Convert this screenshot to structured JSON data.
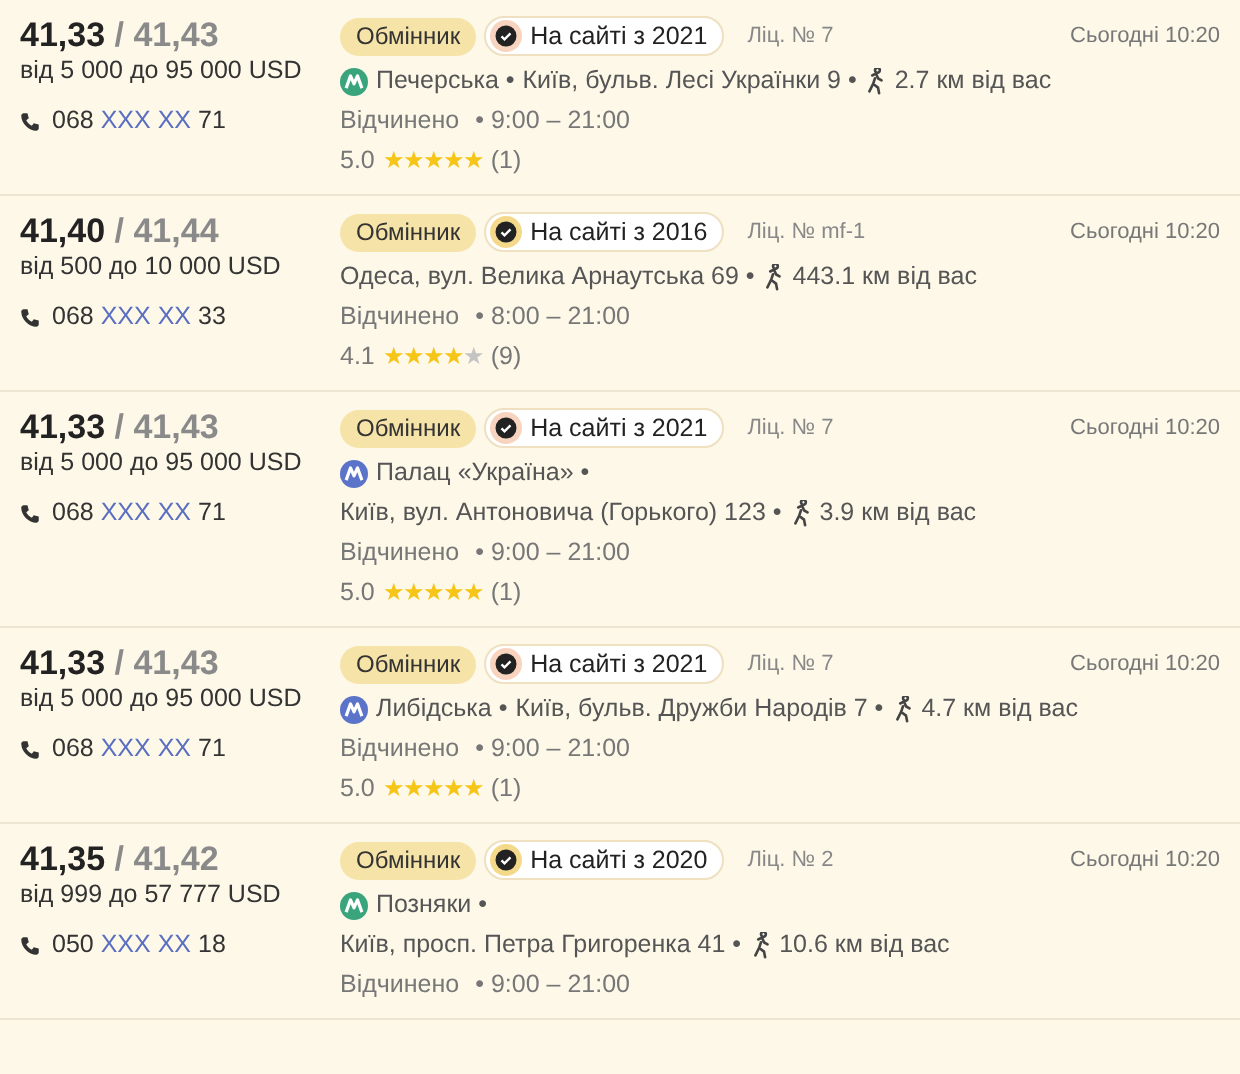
{
  "offers": [
    {
      "buy": "41,33",
      "sell": "/ 41,43",
      "range": "від 5 000 до 95 000 USD",
      "phone": {
        "prefix": "068",
        "hidden": "XXX XX",
        "suffix": "71"
      },
      "type_badge": "Обмінник",
      "since": {
        "text": "На сайті з 2021",
        "color": "#f8d3bd"
      },
      "license": "Ліц. № 7",
      "time": "Сьогодні 10:20",
      "metro": {
        "name": "Печерська •",
        "color": "#3aa57c"
      },
      "address": "Київ, бульв. Лесі Українки 9 •",
      "address_on_new_line": false,
      "distance": "2.7",
      "distance_unit": "км від вас",
      "status": "Відчинено",
      "hours": "• 9:00 – 21:00",
      "rating": "5.0",
      "stars": 5,
      "reviews": "(1)"
    },
    {
      "buy": "41,40",
      "sell": "/ 41,44",
      "range": "від 500 до 10 000 USD",
      "phone": {
        "prefix": "068",
        "hidden": "XXX XX",
        "suffix": "33"
      },
      "type_badge": "Обмінник",
      "since": {
        "text": "На сайті з 2016",
        "color": "#f5d98a"
      },
      "license": "Ліц. № mf-1",
      "time": "Сьогодні 10:20",
      "address": "Одеса, вул. Велика Арнаутська 69 •",
      "distance": "443.1",
      "distance_unit": "км від вас",
      "status": "Відчинено",
      "hours": "• 8:00 – 21:00",
      "rating": "4.1",
      "stars": 4,
      "reviews": "(9)"
    },
    {
      "buy": "41,33",
      "sell": "/ 41,43",
      "range": "від 5 000 до 95 000 USD",
      "phone": {
        "prefix": "068",
        "hidden": "XXX XX",
        "suffix": "71"
      },
      "type_badge": "Обмінник",
      "since": {
        "text": "На сайті з 2021",
        "color": "#f8d3bd"
      },
      "license": "Ліц. № 7",
      "time": "Сьогодні 10:20",
      "metro": {
        "name": "Палац «Україна» •",
        "color": "#5b74c9"
      },
      "address": "Київ, вул. Антоновича (Горького) 123 •",
      "address_on_new_line": true,
      "distance": "3.9",
      "distance_unit": "км від вас",
      "status": "Відчинено",
      "hours": "• 9:00 – 21:00",
      "rating": "5.0",
      "stars": 5,
      "reviews": "(1)"
    },
    {
      "buy": "41,33",
      "sell": "/ 41,43",
      "range": "від 5 000 до 95 000 USD",
      "phone": {
        "prefix": "068",
        "hidden": "XXX XX",
        "suffix": "71"
      },
      "type_badge": "Обмінник",
      "since": {
        "text": "На сайті з 2021",
        "color": "#f8d3bd"
      },
      "license": "Ліц. № 7",
      "time": "Сьогодні 10:20",
      "metro": {
        "name": "Либідська •",
        "color": "#5b74c9"
      },
      "address": "Київ, бульв. Дружби Народів 7 •",
      "address_on_new_line": false,
      "distance": "4.7",
      "distance_unit": "км від вас",
      "status": "Відчинено",
      "hours": "• 9:00 – 21:00",
      "rating": "5.0",
      "stars": 5,
      "reviews": "(1)"
    },
    {
      "buy": "41,35",
      "sell": "/ 41,42",
      "range": "від 999 до 57 777 USD",
      "phone": {
        "prefix": "050",
        "hidden": "XXX XX",
        "suffix": "18"
      },
      "type_badge": "Обмінник",
      "since": {
        "text": "На сайті з 2020",
        "color": "#f5d98a"
      },
      "license": "Ліц. № 2",
      "time": "Сьогодні 10:20",
      "metro": {
        "name": "Позняки •",
        "color": "#3aa57c"
      },
      "address": "Київ, просп. Петра Григоренка 41 •",
      "address_on_new_line": true,
      "distance": "10.6",
      "distance_unit": "км від вас",
      "status": "Відчинено",
      "hours": "• 9:00 – 21:00"
    }
  ]
}
